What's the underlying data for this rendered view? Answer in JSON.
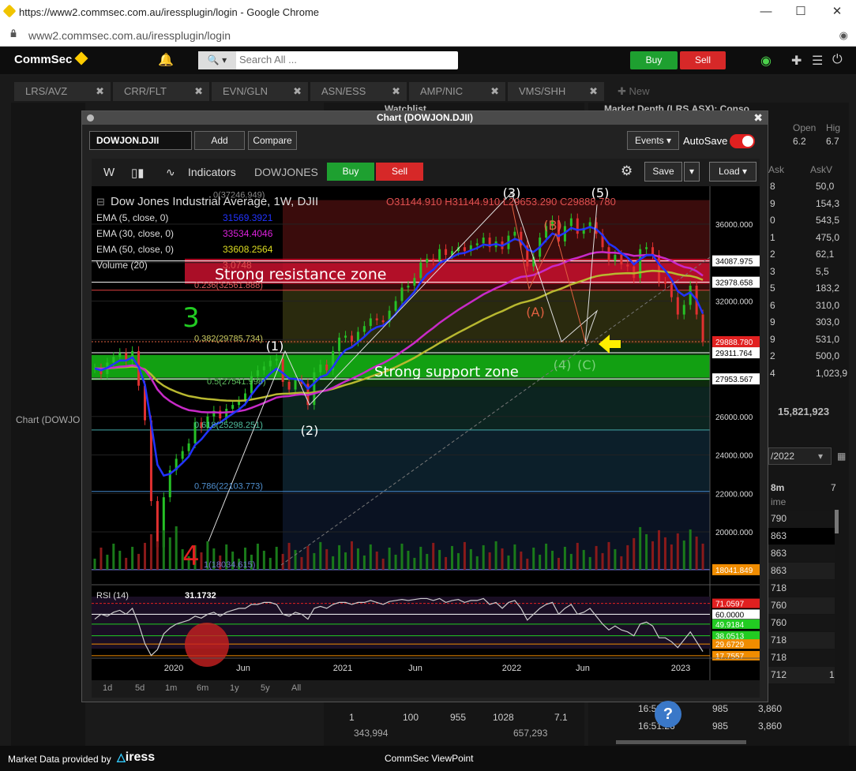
{
  "browser": {
    "title": "https://www2.commsec.com.au/iressplugin/login - Google Chrome",
    "url": "www2.commsec.com.au/iressplugin/login"
  },
  "header": {
    "logo": "CommSec",
    "search_placeholder": "Search All ...",
    "buy_label": "Buy",
    "sell_label": "Sell"
  },
  "tabs": [
    {
      "label": "LRS/AVZ"
    },
    {
      "label": "CRR/FLT"
    },
    {
      "label": "EVN/GLN"
    },
    {
      "label": "ASN/ESS"
    },
    {
      "label": "AMP/NIC"
    },
    {
      "label": "VMS/SHH"
    },
    {
      "label": "New"
    }
  ],
  "panels": {
    "watchlist": "Watchlist",
    "market_depth": "Market Depth (LRS.ASX): Conso...",
    "chart_left": "Chart (DOWJO",
    "depth_open_h": "Open",
    "depth_open": "6.2",
    "depth_high_h": "Hig",
    "depth_high": "6.7",
    "ask_h": "Ask",
    "askv_h": "AskV",
    "ask_values": [
      "8",
      "9",
      "0",
      "1",
      "2",
      "3",
      "5",
      "6",
      "9",
      "9",
      "2",
      "4"
    ],
    "askv_values": [
      "50,0",
      "154,3",
      "543,5",
      "475,0",
      "62,1",
      "5,5",
      "183,2",
      "310,0",
      "303,0",
      "531,0",
      "500,0",
      "1,023,9"
    ],
    "askv_total": "15,821,923",
    "date_field": "/2022",
    "trades_8m": "8m",
    "trades_7": "7",
    "time_h": "ime",
    "trade_rows": [
      "790",
      "863",
      "863",
      "863",
      "718",
      "760",
      "760",
      "718",
      "718",
      "712"
    ],
    "trade_last_col": "1",
    "bottom_rows": [
      [
        "16:53:19",
        "985",
        "3,860"
      ],
      [
        "16:51:26",
        "985",
        "3,860"
      ]
    ],
    "bottom_left": [
      "1",
      "100",
      "955",
      "1028",
      "7.1"
    ],
    "bottom_totals": [
      "343,994",
      "657,293"
    ]
  },
  "chart_window": {
    "title": "Chart (DOWJON.DJII)",
    "symbol": "DOWJON.DJII",
    "add_label": "Add",
    "compare_label": "Compare",
    "events_label": "Events",
    "autosave_label": "AutoSave",
    "interval": "W",
    "indicators_label": "Indicators",
    "symbol_name": "DOWJONES",
    "buy_label": "Buy",
    "sell_label": "Sell",
    "save_label": "Save",
    "load_label": "Load",
    "ranges": [
      "1d",
      "5d",
      "1m",
      "6m",
      "1y",
      "5y",
      "All"
    ]
  },
  "chart_data": {
    "type": "candlestick",
    "title": "Dow Jones Industrial Average, 1W, DJII",
    "ohlc": {
      "o": "31144.910",
      "h": "31144.910",
      "l": "29653.290",
      "c": "29888.780"
    },
    "indicators": [
      {
        "name": "EMA (5, close, 0)",
        "value": "31569.3921",
        "color": "#2233ff"
      },
      {
        "name": "EMA (30, close, 0)",
        "value": "33534.4046",
        "color": "#dd22dd"
      },
      {
        "name": "EMA (50, close, 0)",
        "value": "33608.2564",
        "color": "#dddd22"
      },
      {
        "name": "Volume (20)",
        "value": "3.0748"
      }
    ],
    "y_ticks": [
      "36000.000",
      "34000.000",
      "32000.000",
      "30000.000",
      "28000.000",
      "26000.000",
      "24000.000",
      "22000.000",
      "20000.000"
    ],
    "x_ticks": [
      "2020",
      "Jun",
      "2021",
      "Jun",
      "2022",
      "Jun",
      "2023"
    ],
    "price_tags": [
      {
        "v": "34087.975",
        "bg": "#ffffff",
        "fg": "#000"
      },
      {
        "v": "32978.658",
        "bg": "#ffffff",
        "fg": "#000"
      },
      {
        "v": "29888.780",
        "bg": "#e12020",
        "fg": "#fff"
      },
      {
        "v": "29311.764",
        "bg": "#ffffff",
        "fg": "#000"
      },
      {
        "v": "27953.567",
        "bg": "#ffffff",
        "fg": "#000"
      },
      {
        "v": "18041.849",
        "bg": "#f08c00",
        "fg": "#fff"
      }
    ],
    "fib": [
      {
        "label": "0(37246.949)"
      },
      {
        "label": "0.236(32561.888)"
      },
      {
        "label": "0.382(29785.734)"
      },
      {
        "label": "0.5(27541.998)"
      },
      {
        "label": "0.618(25298.251)"
      },
      {
        "label": "0.786(22103.773)"
      },
      {
        "label": "1(18034.615)"
      }
    ],
    "zones": [
      {
        "label": "Strong resistance zone"
      },
      {
        "label": "Strong support zone"
      }
    ],
    "waves": [
      "(1)",
      "(2)",
      "(3)",
      "(4)",
      "(5)",
      "(A)",
      "(B)",
      "(C)",
      "(4)",
      "3",
      "4"
    ],
    "rsi": {
      "label": "RSI (14)",
      "peak": "31.1732",
      "tags": [
        {
          "v": "71.0597",
          "bg": "#e12020"
        },
        {
          "v": "60.0000",
          "bg": "#ffffff"
        },
        {
          "v": "49.9184",
          "bg": "#22cc22"
        },
        {
          "v": "38.0513",
          "bg": "#22cc22"
        },
        {
          "v": "29.6729",
          "bg": "#f08c00"
        },
        {
          "v": "17.7557",
          "bg": "#f08c00"
        }
      ]
    }
  },
  "footer": {
    "provided": "Market Data provided by",
    "brand": "iress",
    "app": "CommSec ViewPoint"
  }
}
